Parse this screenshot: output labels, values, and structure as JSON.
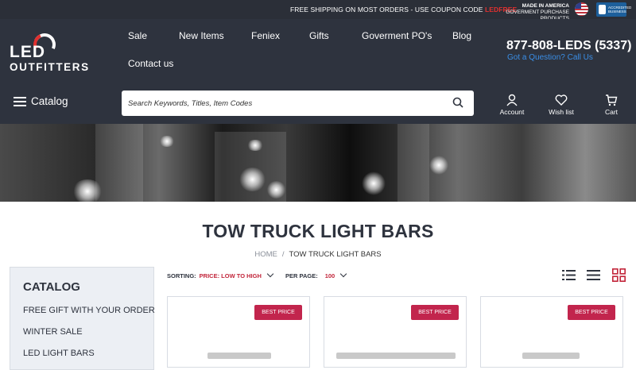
{
  "topbar": {
    "promo_text": "FREE SHIPPING ON MOST ORDERS - USE COUPON CODE ",
    "promo_code": "LEDFREE",
    "made_in_america": "MADE IN AMERICA",
    "gov_products": "GOVERMENT PURCHASE PRODUCTS",
    "bbb_text": "ACCREDITED BUSINESS"
  },
  "logo": {
    "line1": "LED",
    "line2": "OUTFITTERS"
  },
  "nav": {
    "items": [
      "Sale",
      "New Items",
      "Feniex",
      "Gifts",
      "Goverment PO's",
      "Blog",
      "Contact us"
    ]
  },
  "contact": {
    "phone": "877-808-LEDS (5337)",
    "question": "Got a Question? Call Us"
  },
  "catalog_button": {
    "label": "Catalog"
  },
  "search": {
    "placeholder": "Search Keywords, Titles, Item Codes"
  },
  "header_icons": {
    "account": "Account",
    "wishlist": "Wish list",
    "cart": "Cart"
  },
  "page": {
    "title": "TOW TRUCK LIGHT BARS",
    "breadcrumb_home": "HOME",
    "breadcrumb_sep": "/",
    "breadcrumb_current": "TOW TRUCK LIGHT BARS"
  },
  "sidebar": {
    "heading": "CATALOG",
    "items": [
      "FREE GIFT WITH YOUR ORDER",
      "WINTER SALE",
      "LED LIGHT BARS"
    ]
  },
  "toolbar": {
    "sorting_label": "SORTING:",
    "sorting_value": "PRICE: LOW TO HIGH",
    "per_page_label": "PER PAGE:",
    "per_page_value": "100"
  },
  "products": [
    {
      "badge": "BEST PRICE"
    },
    {
      "badge": "BEST PRICE"
    },
    {
      "badge": "BEST PRICE"
    }
  ],
  "colors": {
    "header_bg": "#2e333e",
    "accent_red": "#c2254d",
    "link_blue": "#3a8ee6"
  }
}
